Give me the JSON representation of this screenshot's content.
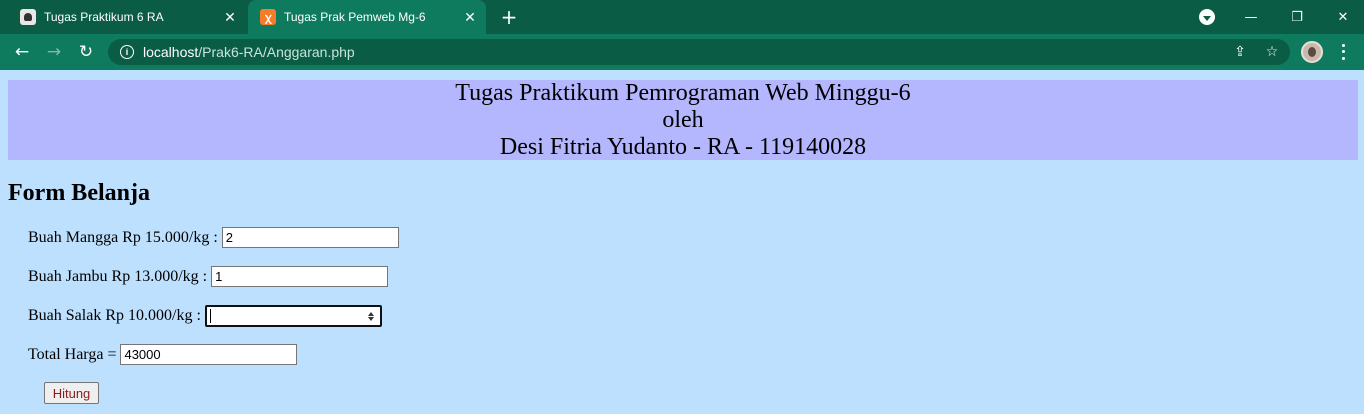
{
  "browser": {
    "tabs": [
      {
        "title": "Tugas Praktikum 6 RA",
        "active": false
      },
      {
        "title": "Tugas Prak Pemweb Mg-6",
        "active": true
      }
    ],
    "url_host": "localhost",
    "url_path": "/Prak6-RA/Anggaran.php",
    "theme_color": "#0f7b5e"
  },
  "page": {
    "header": {
      "line1": "Tugas Praktikum Pemrograman Web Minggu-6",
      "line2": "oleh",
      "line3": "Desi Fitria Yudanto - RA - 119140028",
      "background": "#b4b6fe"
    },
    "background": "#bde0fe",
    "form_title": "Form Belanja",
    "fields": {
      "mangga_label": "Buah Mangga Rp 15.000/kg :",
      "mangga_value": "2",
      "jambu_label": "Buah Jambu Rp 13.000/kg :",
      "jambu_value": "1",
      "salak_label": "Buah Salak Rp 10.000/kg :",
      "salak_value": "",
      "total_label": "Total Harga =",
      "total_value": "43000"
    },
    "submit_label": "Hitung"
  }
}
